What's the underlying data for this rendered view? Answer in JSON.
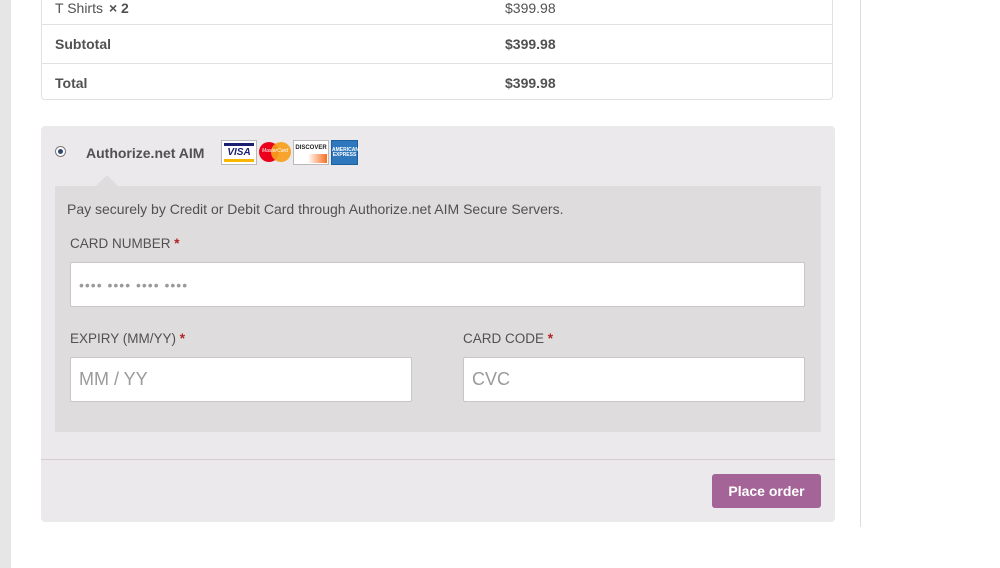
{
  "order_review": {
    "rows": [
      {
        "label": "T Shirts",
        "qty": "× 2",
        "value": "$399.98"
      },
      {
        "label": "Subtotal",
        "value": "$399.98"
      },
      {
        "label": "Total",
        "value": "$399.98"
      }
    ]
  },
  "payment": {
    "method_title": "Authorize.net AIM",
    "cards": {
      "visa": "VISA",
      "mastercard": "MasterCard",
      "discover": "DISCOVER",
      "amex": "AMERICAN EXPRESS"
    },
    "description": "Pay securely by Credit or Debit Card through Authorize.net AIM Secure Servers.",
    "fields": {
      "card_number": {
        "label": "CARD NUMBER",
        "required_mark": "*",
        "placeholder": "•••• •••• •••• ••••"
      },
      "expiry": {
        "label": "EXPIRY (MM/YY)",
        "required_mark": "*",
        "placeholder": "MM / YY"
      },
      "card_code": {
        "label": "CARD CODE",
        "required_mark": "*",
        "placeholder": "CVC"
      }
    },
    "place_order_label": "Place order"
  },
  "colors": {
    "button": "#a46497",
    "panel": "#dfdcde",
    "box": "#ebe9eb",
    "required": "#b22222"
  }
}
